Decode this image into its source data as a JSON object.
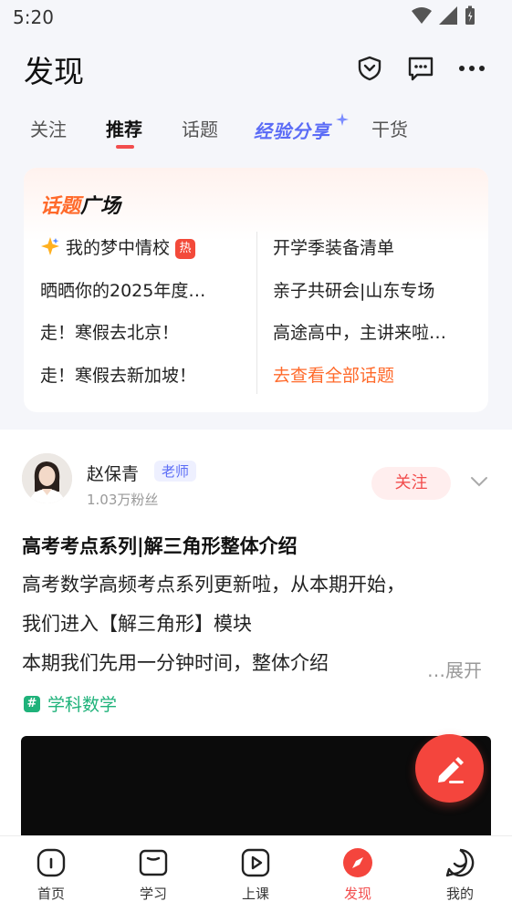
{
  "status_bar": {
    "time": "5:20"
  },
  "header": {
    "title": "发现"
  },
  "tabs": [
    {
      "label": "关注"
    },
    {
      "label": "推荐"
    },
    {
      "label": "话题"
    },
    {
      "label": "经验分享"
    },
    {
      "label": "干货"
    }
  ],
  "active_tab": "推荐",
  "topic_square": {
    "title_part1": "话题",
    "title_part2": "广场",
    "left_items": [
      {
        "label": "我的梦中情校",
        "badge": "热"
      },
      {
        "label": "晒晒你的2025年度…"
      },
      {
        "label": "走！寒假去北京！"
      },
      {
        "label": "走！寒假去新加坡！"
      }
    ],
    "right_items": [
      {
        "label": "开学季装备清单"
      },
      {
        "label": "亲子共研会|山东专场"
      },
      {
        "label": "高途高中，主讲来啦…"
      },
      {
        "label": "去查看全部话题"
      }
    ]
  },
  "post": {
    "author": "赵保青",
    "role_badge": "老师",
    "fans": "1.03万粉丝",
    "follow_label": "关注",
    "title": "高考考点系列|解三角形整体介绍",
    "lines": [
      "高考数学高频考点系列更新啦，从本期开始，",
      "我们进入【解三角形】模块",
      "本期我们先用一分钟时间，整体介绍"
    ],
    "expand_label": "…展开",
    "tag": "学科数学"
  },
  "bottom_nav": [
    {
      "label": "首页",
      "icon": "home-icon"
    },
    {
      "label": "学习",
      "icon": "study-icon"
    },
    {
      "label": "上课",
      "icon": "play-icon"
    },
    {
      "label": "发现",
      "icon": "compass-icon"
    },
    {
      "label": "我的",
      "icon": "profile-icon"
    }
  ],
  "active_nav": "发现",
  "colors": {
    "accent": "#f24d4d",
    "topic_orange": "#ff6a2b",
    "tag_green": "#1fb27a",
    "badge_blue": "#5b6cf6"
  }
}
